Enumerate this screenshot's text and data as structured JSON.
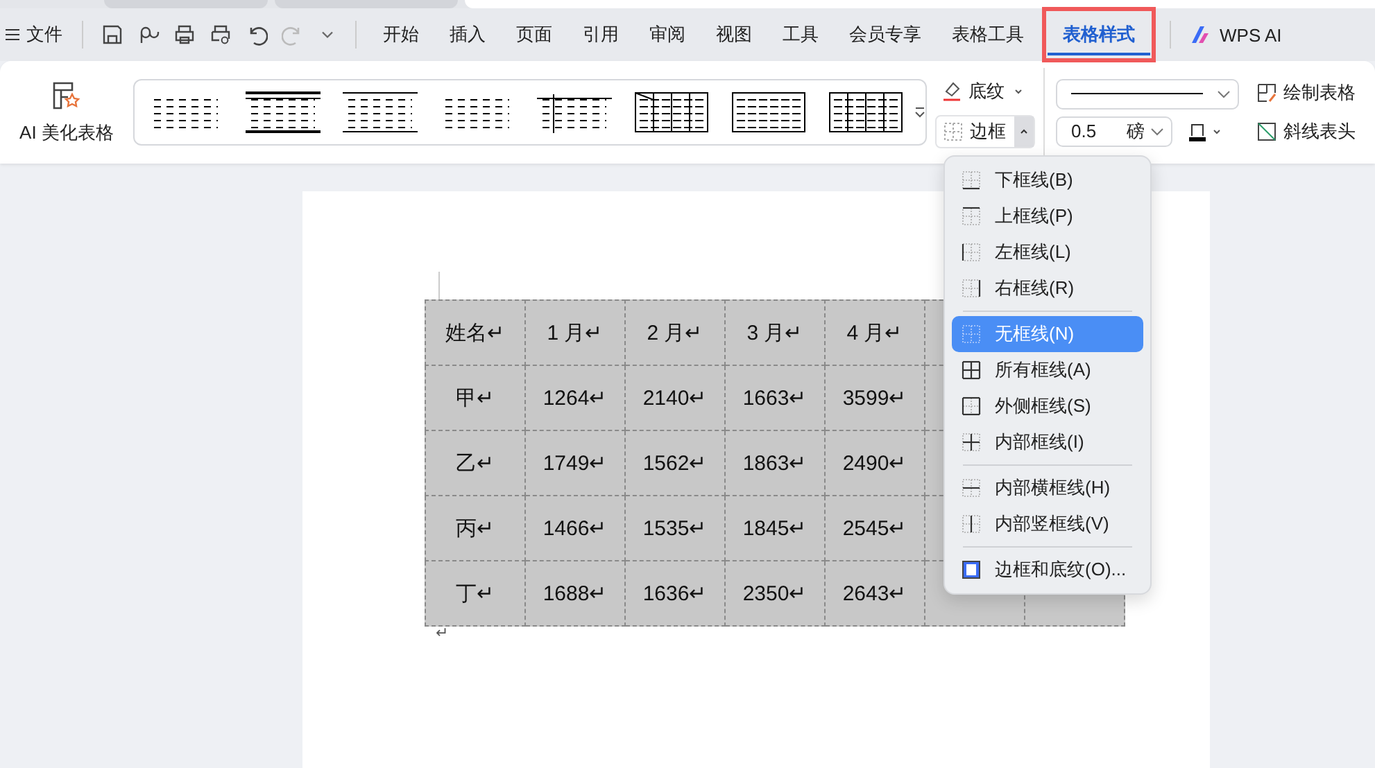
{
  "window_tabs": [
    {
      "selected": false
    },
    {
      "selected": false
    },
    {
      "selected": true
    }
  ],
  "menu_bar": {
    "file_label": "文件",
    "tabs": [
      {
        "label": "开始",
        "selected": false,
        "highlighted": false
      },
      {
        "label": "插入",
        "selected": false,
        "highlighted": false
      },
      {
        "label": "页面",
        "selected": false,
        "highlighted": false
      },
      {
        "label": "引用",
        "selected": false,
        "highlighted": false
      },
      {
        "label": "审阅",
        "selected": false,
        "highlighted": false
      },
      {
        "label": "视图",
        "selected": false,
        "highlighted": false
      },
      {
        "label": "工具",
        "selected": false,
        "highlighted": false
      },
      {
        "label": "会员专享",
        "selected": false,
        "highlighted": false
      },
      {
        "label": "表格工具",
        "selected": false,
        "highlighted": false
      },
      {
        "label": "表格样式",
        "selected": true,
        "highlighted": true
      }
    ],
    "ai_label": "WPS AI"
  },
  "ribbon": {
    "ai_beautify": "AI 美化表格",
    "shading": "底纹",
    "border": {
      "label": "边框",
      "expanded": true
    },
    "line_weight": {
      "value": "0.5",
      "unit": "磅"
    },
    "draw_table": "绘制表格",
    "diagonal_header": "斜线表头"
  },
  "table": {
    "header": [
      "姓名↵",
      "1 月↵",
      "2 月↵",
      "3 月↵",
      "4 月↵"
    ],
    "rows": [
      [
        "甲↵",
        "1264↵",
        "2140↵",
        "1663↵",
        "3599↵"
      ],
      [
        "乙↵",
        "1749↵",
        "1562↵",
        "1863↵",
        "2490↵"
      ],
      [
        "丙↵",
        "1466↵",
        "1535↵",
        "1845↵",
        "2545↵"
      ],
      [
        "丁↵",
        "1688↵",
        "1636↵",
        "2350↵",
        "2643↵"
      ]
    ],
    "after_mark": "↵"
  },
  "border_menu": {
    "groups": [
      [
        {
          "label": "下框线(B)",
          "kind": "bottom",
          "selected": false
        },
        {
          "label": "上框线(P)",
          "kind": "top",
          "selected": false
        },
        {
          "label": "左框线(L)",
          "kind": "left",
          "selected": false
        },
        {
          "label": "右框线(R)",
          "kind": "right",
          "selected": false
        }
      ],
      [
        {
          "label": "无框线(N)",
          "kind": "none",
          "selected": true
        },
        {
          "label": "所有框线(A)",
          "kind": "all",
          "selected": false
        },
        {
          "label": "外侧框线(S)",
          "kind": "outside",
          "selected": false
        },
        {
          "label": "内部框线(I)",
          "kind": "inside",
          "selected": false
        }
      ],
      [
        {
          "label": "内部横框线(H)",
          "kind": "inside_h",
          "selected": false
        },
        {
          "label": "内部竖框线(V)",
          "kind": "inside_v",
          "selected": false
        }
      ],
      [
        {
          "label": "边框和底纹(O)...",
          "kind": "dialog",
          "selected": false
        }
      ]
    ]
  }
}
